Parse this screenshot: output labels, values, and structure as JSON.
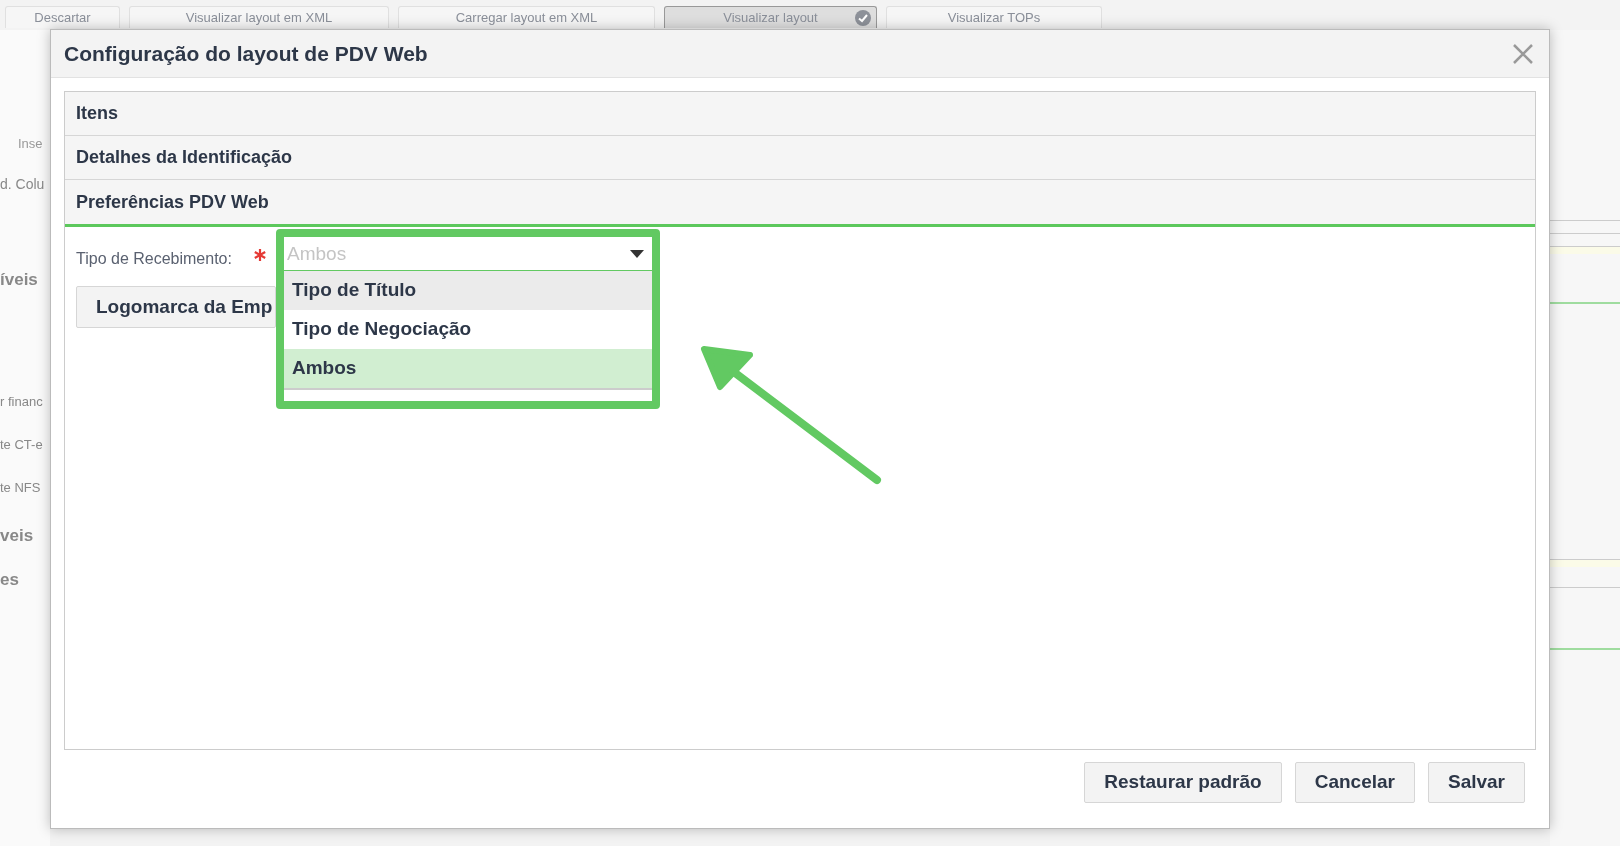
{
  "background": {
    "toolbar_buttons": [
      {
        "label": "Descartar",
        "selected": false
      },
      {
        "label": "Visualizar layout em XML",
        "selected": false
      },
      {
        "label": "Carregar layout em XML",
        "selected": false
      },
      {
        "label": "Visualizar layout",
        "selected": true
      },
      {
        "label": "Visualizar TOPs",
        "selected": false
      }
    ],
    "side_texts": [
      {
        "text": "Inse",
        "kind": "tab"
      },
      {
        "text": "d. Colu",
        "kind": "label"
      },
      {
        "text": "íveis",
        "kind": "heading"
      },
      {
        "text": "r financ",
        "kind": "item"
      },
      {
        "text": "te CT-e",
        "kind": "item"
      },
      {
        "text": "te NFS",
        "kind": "item"
      },
      {
        "text": "veis",
        "kind": "heading"
      },
      {
        "text": "es",
        "kind": "heading"
      }
    ]
  },
  "dialog": {
    "title": "Configuração do layout de PDV Web",
    "sections": [
      {
        "title": "Itens",
        "expanded": false
      },
      {
        "title": "Detalhes da Identificação",
        "expanded": false
      },
      {
        "title": "Preferências PDV Web",
        "expanded": true
      }
    ],
    "field": {
      "label": "Tipo de Recebimento:",
      "required": true,
      "placeholder": "Ambos",
      "options": [
        {
          "label": "Tipo de Título",
          "selected": false,
          "hovered": true
        },
        {
          "label": "Tipo de Negociação",
          "selected": false,
          "hovered": false
        },
        {
          "label": "Ambos",
          "selected": true,
          "hovered": false
        }
      ]
    },
    "logo_button": "Logomarca da Emp",
    "buttons": [
      "Restaurar padrão",
      "Cancelar",
      "Salvar"
    ]
  }
}
